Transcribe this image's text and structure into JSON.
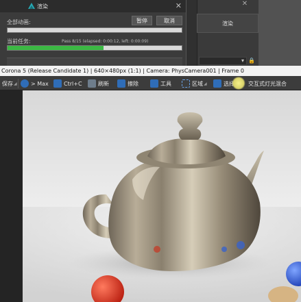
{
  "dialog": {
    "title": "渲染",
    "all_frames_label": "全部动画:",
    "pause_button": "暂停",
    "cancel_button": "取消",
    "current_task_label": "当前任务:",
    "task_detail": "Pass 8/15 (elapsed: 0:00:12, left: 0:00:09)",
    "current_task_progress": 0.55,
    "all_frames_progress": 0.0
  },
  "background": {
    "render_button": "渲染"
  },
  "vfb": {
    "title": "Corona 5 (Release Candidate 1) | 640×480px (1:1) | Camera: PhysCamera001 | Frame 0"
  },
  "toolbar": {
    "save": "保存",
    "max": "> Max",
    "copy": "Ctrl+C",
    "refresh": "刷新",
    "clear": "擦除",
    "tools": "工具",
    "region": "区域",
    "select": "选择",
    "interactive_lightmix": "交互式灯光混合"
  },
  "colors": {
    "accent_green": "#3bb843",
    "toolbar_blue_icon": "#2f6db8",
    "select_highlight": "#f6f08a"
  }
}
